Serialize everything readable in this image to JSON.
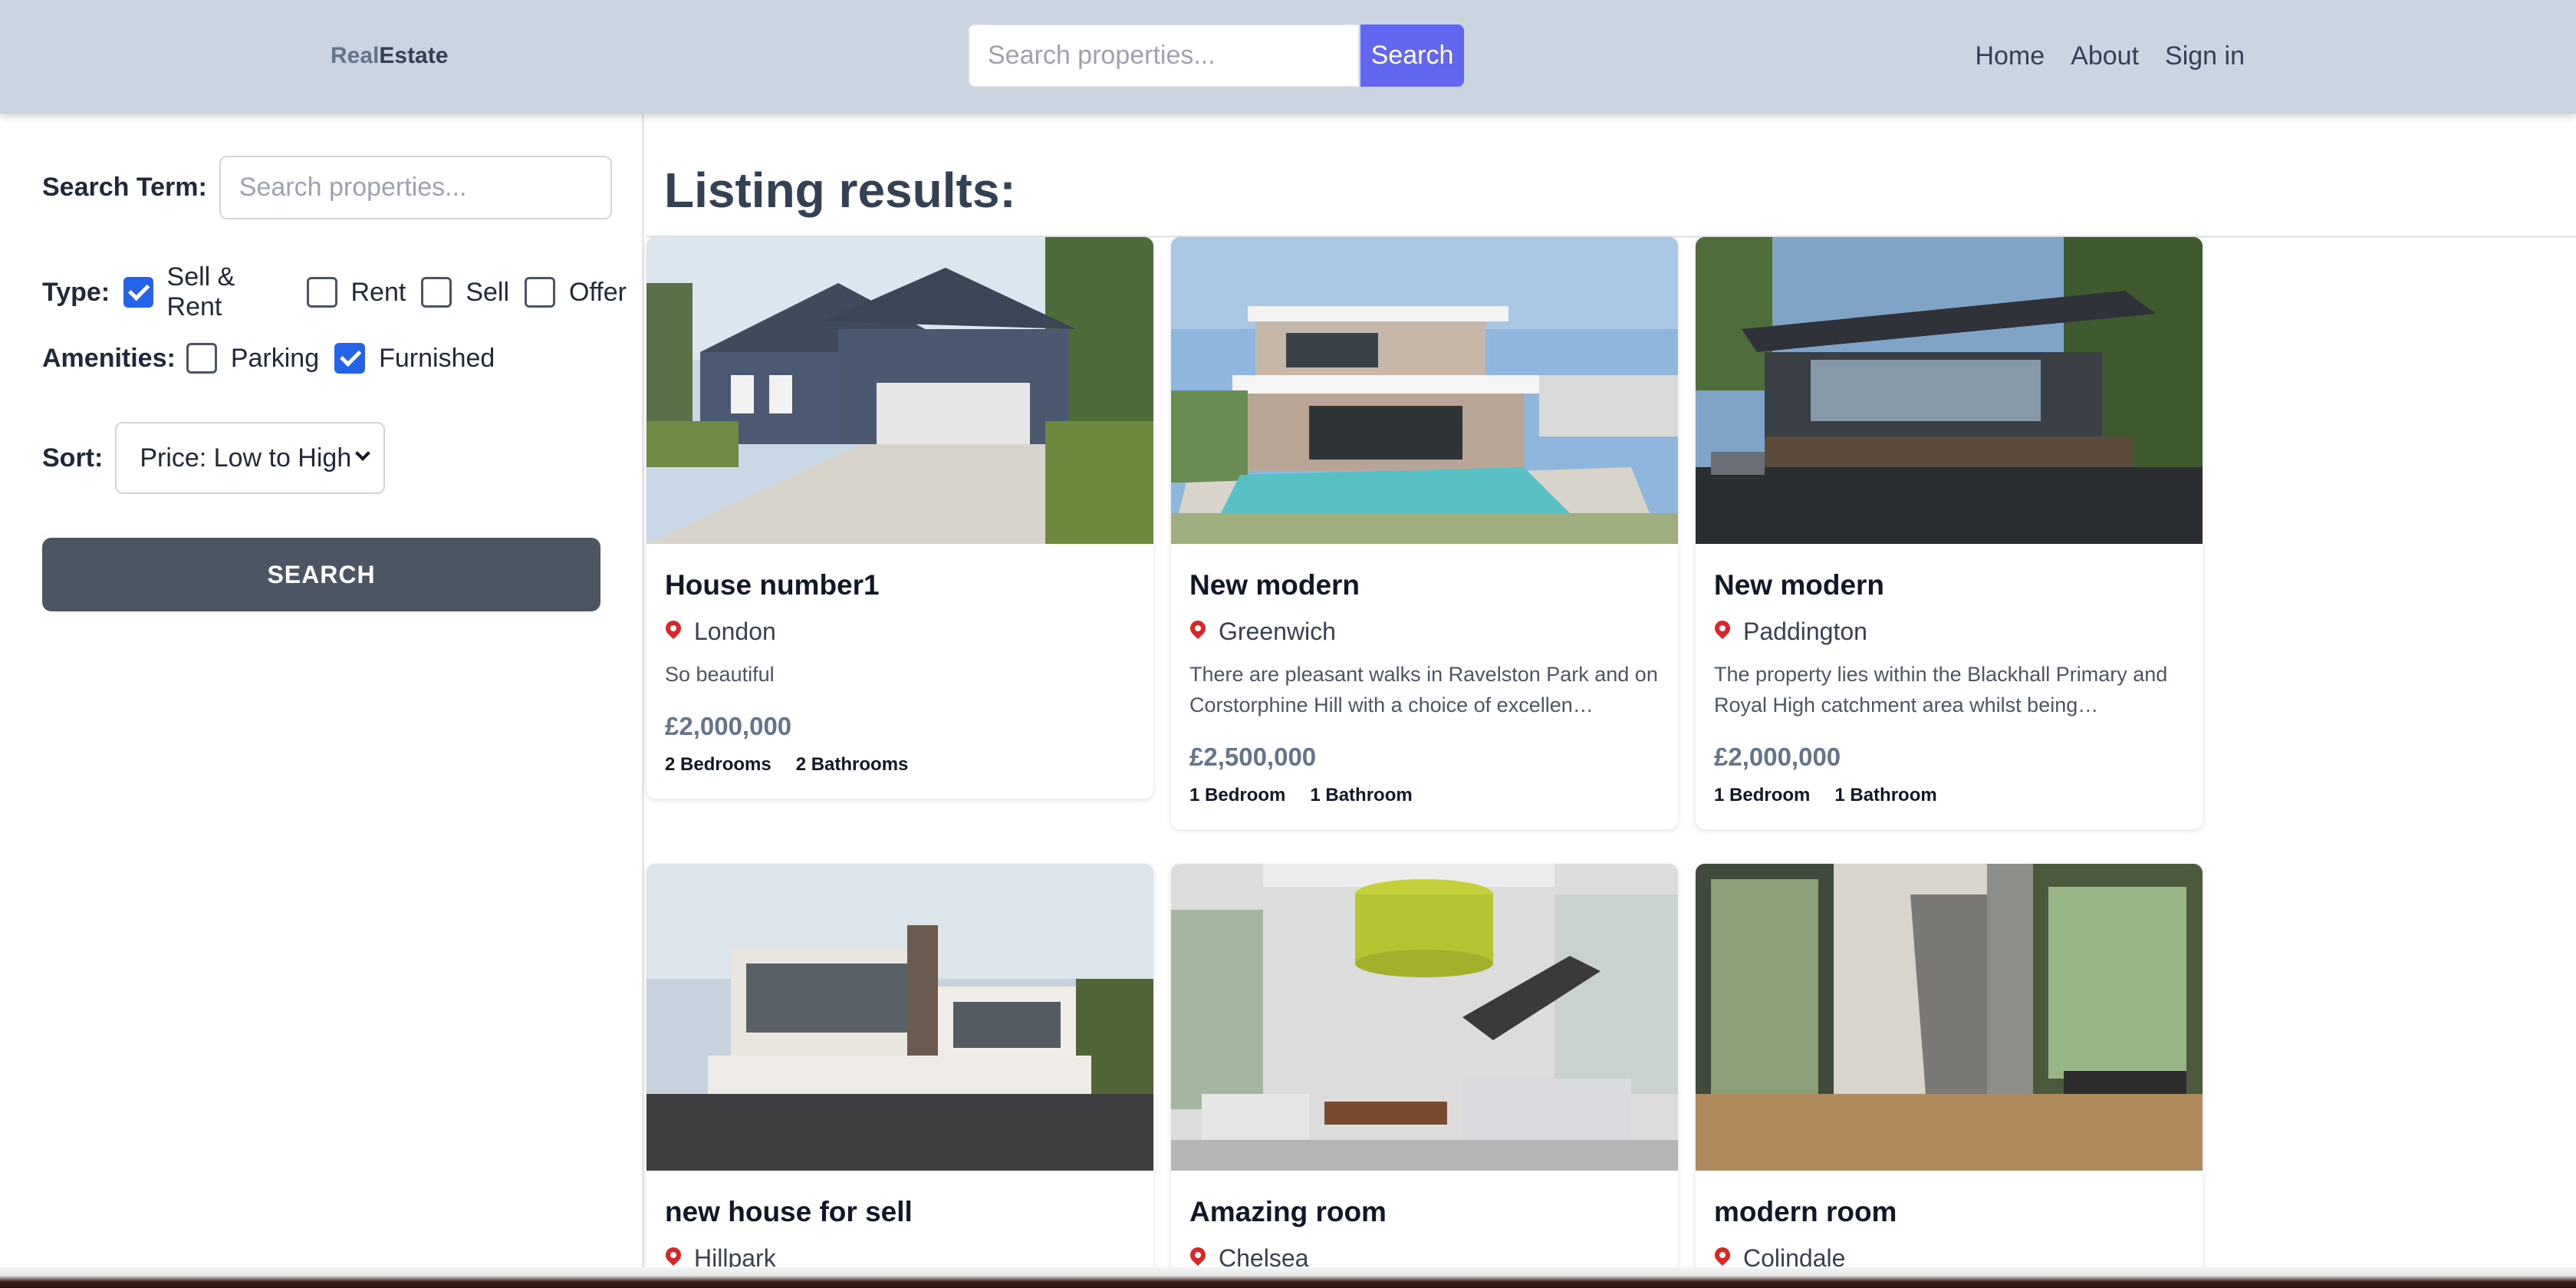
{
  "header": {
    "logo_part1": "Real",
    "logo_part2": "Estate",
    "search_placeholder": "Search properties...",
    "search_button": "Search",
    "nav": [
      "Home",
      "About",
      "Sign in"
    ]
  },
  "sidebar": {
    "search_label": "Search Term:",
    "search_placeholder": "Search properties...",
    "type_label": "Type:",
    "types": [
      {
        "label": "Sell & Rent",
        "checked": true
      },
      {
        "label": "Rent",
        "checked": false
      },
      {
        "label": "Sell",
        "checked": false
      },
      {
        "label": "Offer",
        "checked": false
      }
    ],
    "amenities_label": "Amenities:",
    "amenities": [
      {
        "label": "Parking",
        "checked": false
      },
      {
        "label": "Furnished",
        "checked": true
      }
    ],
    "sort_label": "Sort:",
    "sort_value": "Price: Low to High",
    "submit_label": "SEARCH"
  },
  "main": {
    "title": "Listing results:",
    "listings": [
      {
        "name": "House number1",
        "location": "London",
        "description": "So beautiful",
        "price": "£2,000,000",
        "bedrooms": "2 Bedrooms",
        "bathrooms": "2 Bathrooms"
      },
      {
        "name": "New modern",
        "location": "Greenwich",
        "description": "There are pleasant walks in Ravelston Park and on Corstorphine Hill with a choice of excellen…",
        "price": "£2,500,000",
        "bedrooms": "1 Bedroom",
        "bathrooms": "1 Bathroom"
      },
      {
        "name": "New modern",
        "location": "Paddington",
        "description": "The property lies within the Blackhall Primary and Royal High catchment area whilst being…",
        "price": "£2,000,000",
        "bedrooms": "1 Bedroom",
        "bathrooms": "1 Bathroom"
      },
      {
        "name": "new house for sell",
        "location": "Hillpark"
      },
      {
        "name": "Amazing room",
        "location": "Chelsea"
      },
      {
        "name": "modern room",
        "location": "Colindale"
      }
    ]
  },
  "colors": {
    "header_bg": "#cbd5e1",
    "search_button": "#6366f1",
    "submit_button": "#4b5563",
    "checkbox_checked": "#2563eb",
    "pin": "#dc2626"
  }
}
